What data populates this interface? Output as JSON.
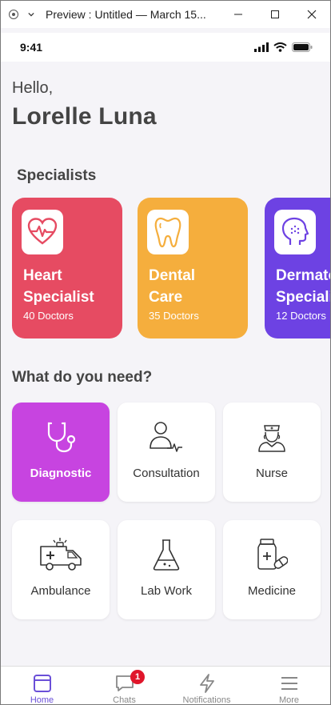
{
  "window": {
    "title": "Preview : Untitled — March 15..."
  },
  "status_bar": {
    "time": "9:41"
  },
  "greeting": {
    "hello": "Hello,",
    "name": "Lorelle Luna"
  },
  "specialists": {
    "title": "Specialists",
    "items": [
      {
        "title": "Heart\nSpecialist",
        "count": "40 Doctors",
        "color": "#e64b62",
        "icon": "heart-pulse-icon"
      },
      {
        "title": "Dental\nCare",
        "count": "35 Doctors",
        "color": "#f5ae3d",
        "icon": "tooth-icon"
      },
      {
        "title": "Dermatology\nSpecialist",
        "count": "12 Doctors",
        "color": "#6d42e3",
        "icon": "head-profile-icon"
      }
    ]
  },
  "needs": {
    "title": "What do you need?",
    "items": [
      {
        "label": "Diagnostic",
        "icon": "stethoscope-icon",
        "active": true
      },
      {
        "label": "Consultation",
        "icon": "doctor-consultation-icon",
        "active": false
      },
      {
        "label": "Nurse",
        "icon": "nurse-icon",
        "active": false
      },
      {
        "label": "Ambulance",
        "icon": "ambulance-icon",
        "active": false
      },
      {
        "label": "Lab Work",
        "icon": "flask-icon",
        "active": false
      },
      {
        "label": "Medicine",
        "icon": "medicine-icon",
        "active": false
      }
    ],
    "active_color": "#c744e0"
  },
  "bottom_nav": {
    "items": [
      {
        "label": "Home",
        "icon": "home-icon",
        "active": true
      },
      {
        "label": "Chats",
        "icon": "chat-icon",
        "badge": "1"
      },
      {
        "label": "Notifications",
        "icon": "lightning-icon"
      },
      {
        "label": "More",
        "icon": "menu-icon"
      }
    ],
    "accent_color": "#6a4fd8"
  }
}
